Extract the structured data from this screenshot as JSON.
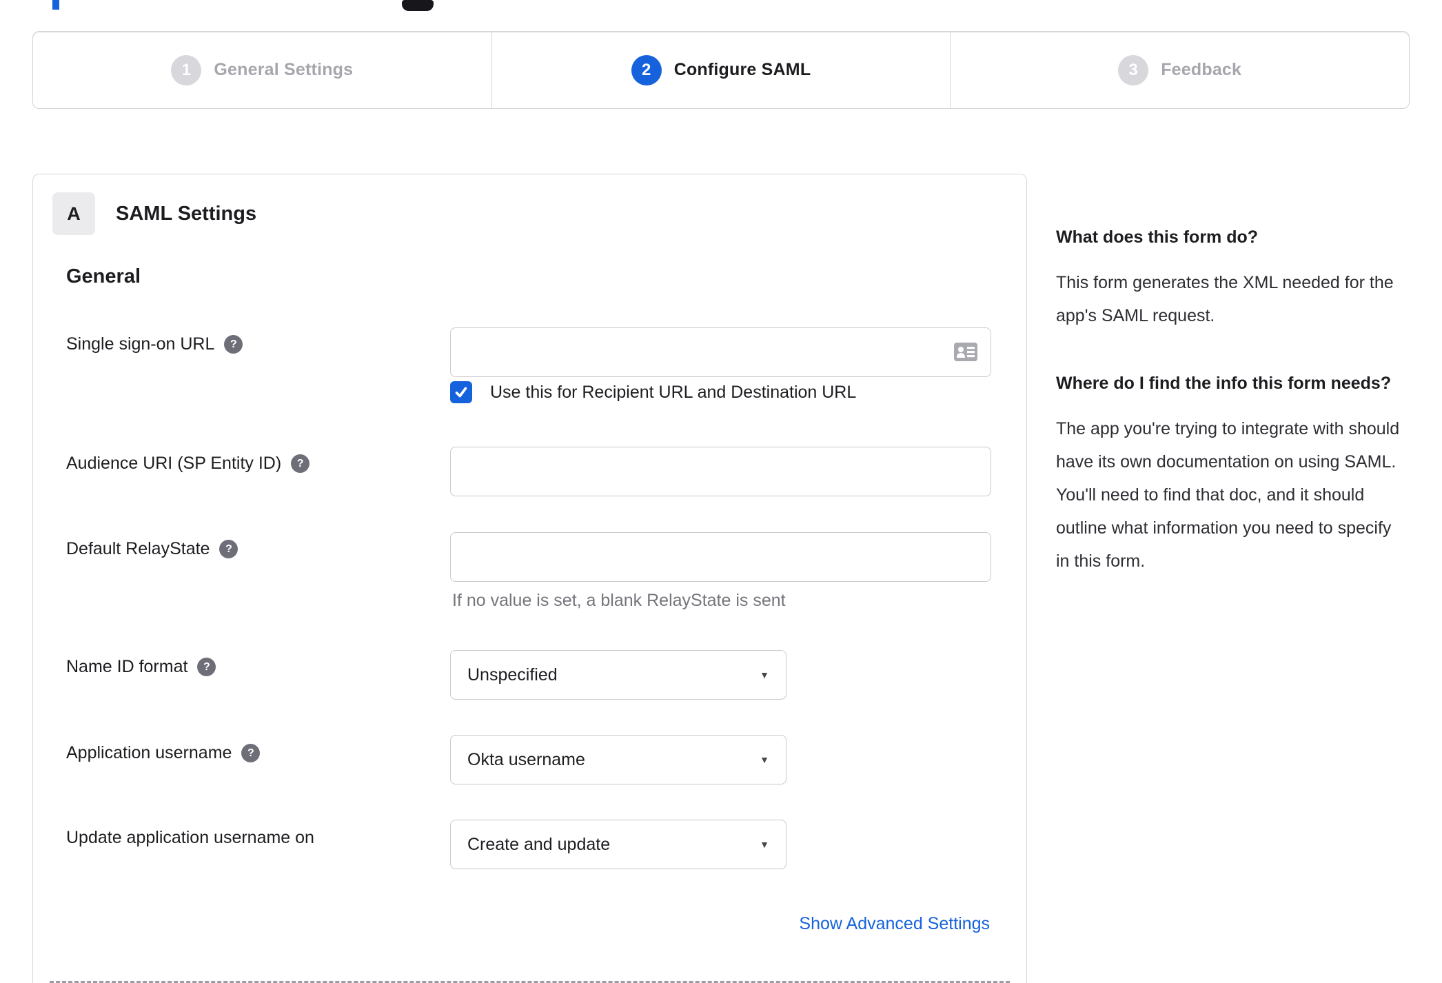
{
  "colors": {
    "accent_blue": "#1662dd",
    "inactive_gray": "#d7d7dc",
    "text_dark": "#1d1d21",
    "hint_gray": "#75757c"
  },
  "icons": {
    "help": "?",
    "caret_down": "▼",
    "check": "checkmark",
    "contact_card": "contact-card"
  },
  "stepper": {
    "steps": [
      {
        "number": "1",
        "label": "General Settings",
        "state": "inactive"
      },
      {
        "number": "2",
        "label": "Configure SAML",
        "state": "active"
      },
      {
        "number": "3",
        "label": "Feedback",
        "state": "inactive"
      }
    ]
  },
  "panel": {
    "badge": "A",
    "title": "SAML Settings",
    "section_title": "General",
    "fields": {
      "sso": {
        "label": "Single sign-on URL",
        "value": "",
        "checkbox_label": "Use this for Recipient URL and Destination URL",
        "checked": true
      },
      "audience": {
        "label": "Audience URI (SP Entity ID)",
        "value": ""
      },
      "relay": {
        "label": "Default RelayState",
        "value": "",
        "hint": "If no value is set, a blank RelayState is sent"
      },
      "name_id": {
        "label": "Name ID format",
        "value": "Unspecified"
      },
      "app_username": {
        "label": "Application username",
        "value": "Okta username"
      },
      "update_username": {
        "label": "Update application username on",
        "value": "Create and update"
      }
    },
    "advanced_link": "Show Advanced Settings"
  },
  "sidebar": {
    "q1": {
      "heading": "What does this form do?",
      "body": "This form generates the XML needed for the app's SAML request."
    },
    "q2": {
      "heading": "Where do I find the info this form needs?",
      "body": "The app you're trying to integrate with should have its own documentation on using SAML. You'll need to find that doc, and it should outline what information you need to specify in this form."
    }
  }
}
